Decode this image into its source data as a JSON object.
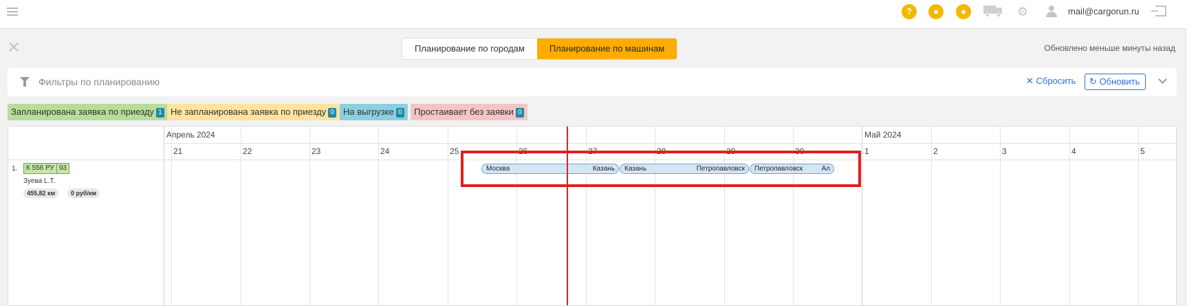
{
  "header": {
    "icons": [
      "help-icon",
      "chat-icon",
      "fire-icon",
      "truck-icon",
      "gear-icon",
      "user-icon",
      "logout-icon"
    ],
    "user_email": "mail@cargorun.ru"
  },
  "tabs": [
    {
      "label": "Планирование по городам",
      "active": false
    },
    {
      "label": "Планирование по машинам",
      "active": true
    }
  ],
  "status": {
    "updated": "Обновлено меньше минуты назад"
  },
  "filters": {
    "placeholder": "Фильтры по планированию",
    "reset_label": "Сбросить",
    "refresh_label": "Обновить"
  },
  "legend": [
    {
      "label": "Запланирована заявка по приезду",
      "count": "1",
      "color": "#b7dd9a"
    },
    {
      "label": "Не запланирована заявка по приезду",
      "count": "0",
      "color": "#fde3a0"
    },
    {
      "label": "На выгрузке",
      "count": "0",
      "color": "#8ccfe0"
    },
    {
      "label": "Простаивает без заявки",
      "count": "0",
      "color": "#f4c5c5"
    }
  ],
  "timeline": {
    "months": [
      "Апрель 2024",
      "Май 2024"
    ],
    "days": [
      "21",
      "22",
      "23",
      "24",
      "25",
      "26",
      "27",
      "28",
      "29",
      "30",
      "1",
      "2",
      "3",
      "4",
      "5"
    ]
  },
  "vehicles": [
    {
      "index": "1.",
      "plate_number": "К 556 РУ",
      "plate_region": "93",
      "driver": "Зуева L.T.",
      "distance": "455,82 км",
      "rate": "0 руб/км",
      "trips": [
        {
          "from": "Москва",
          "to": "Казань"
        },
        {
          "from": "Казань",
          "to": "Петропавловск"
        },
        {
          "from": "Петропавловск",
          "to": "Ал"
        }
      ]
    }
  ]
}
